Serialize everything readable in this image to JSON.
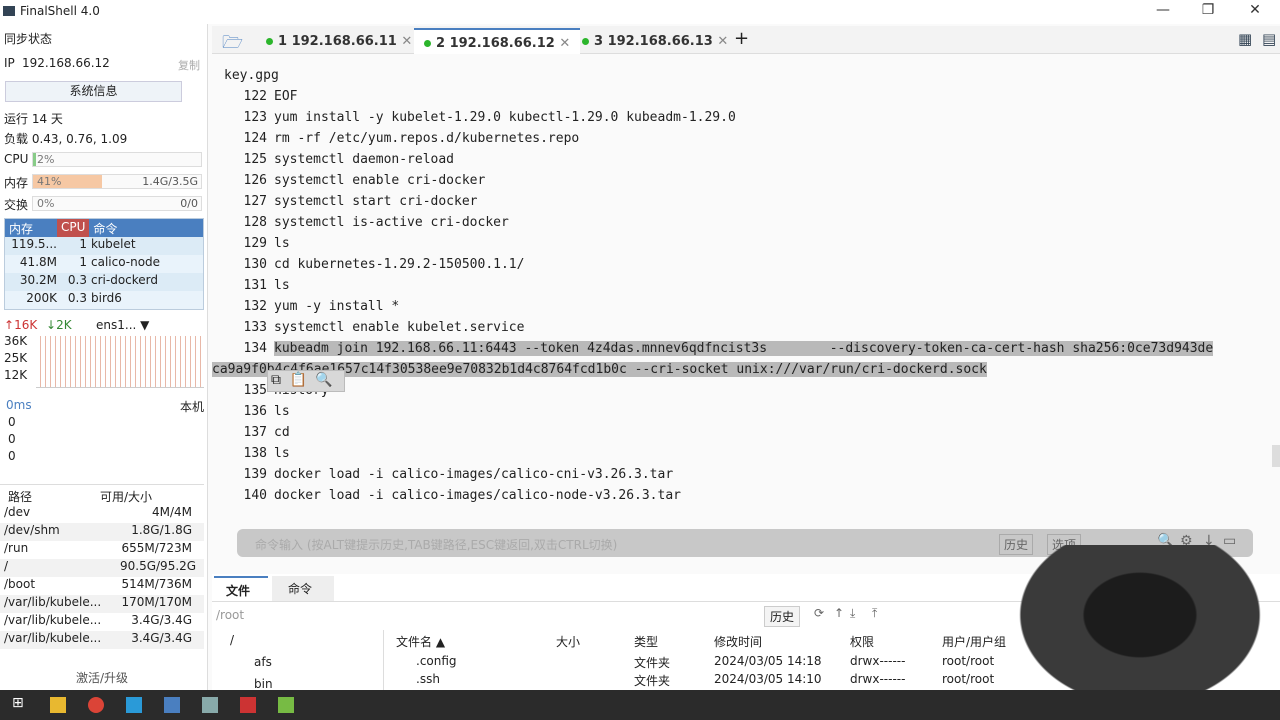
{
  "window": {
    "title": "FinalShell 4.0"
  },
  "sidebar": {
    "sync_label": "同步状态",
    "ip_label": "IP",
    "ip": "192.168.66.12",
    "copy_label": "复制",
    "sysinfo_button": "系统信息",
    "uptime": "运行 14 天",
    "load": "负载 0.43, 0.76, 1.09",
    "cpu": {
      "label": "CPU",
      "text": "2%",
      "percent": 2
    },
    "mem": {
      "label": "内存",
      "text": "41%",
      "percent": 41,
      "usage": "1.4G/3.5G"
    },
    "swap": {
      "label": "交换",
      "text": "0%",
      "percent": 0,
      "usage": "0/0"
    },
    "proc_headers": [
      "内存",
      "CPU",
      "命令"
    ],
    "processes": [
      {
        "mem": "119.5...",
        "cpu": "1",
        "cmd": "kubelet"
      },
      {
        "mem": "41.8M",
        "cpu": "1",
        "cmd": "calico-node"
      },
      {
        "mem": "30.2M",
        "cpu": "0.3",
        "cmd": "cri-dockerd"
      },
      {
        "mem": "200K",
        "cpu": "0.3",
        "cmd": "bird6"
      }
    ],
    "net": {
      "up": "16K",
      "down": "2K",
      "iface": "ens1...",
      "ticks": [
        "36K",
        "25K",
        "12K"
      ]
    },
    "ping": {
      "label": "0ms",
      "host": "本机",
      "values": [
        "0",
        "0",
        "0"
      ]
    },
    "disk_headers": [
      "路径",
      "可用/大小"
    ],
    "disks": [
      {
        "path": "/dev",
        "size": "4M/4M"
      },
      {
        "path": "/dev/shm",
        "size": "1.8G/1.8G"
      },
      {
        "path": "/run",
        "size": "655M/723M"
      },
      {
        "path": "/",
        "size": "90.5G/95.2G"
      },
      {
        "path": "/boot",
        "size": "514M/736M"
      },
      {
        "path": "/var/lib/kubele...",
        "size": "170M/170M"
      },
      {
        "path": "/var/lib/kubele...",
        "size": "3.4G/3.4G"
      },
      {
        "path": "/var/lib/kubele...",
        "size": "3.4G/3.4G"
      }
    ],
    "activate": "激活/升级"
  },
  "tabs": [
    {
      "label": "1 192.168.66.11"
    },
    {
      "label": "2 192.168.66.12"
    },
    {
      "label": "3 192.168.66.13"
    }
  ],
  "terminal": {
    "first": "key.gpg",
    "lines": [
      {
        "n": "122",
        "t": "EOF"
      },
      {
        "n": "123",
        "t": "yum install -y kubelet-1.29.0 kubectl-1.29.0 kubeadm-1.29.0"
      },
      {
        "n": "124",
        "t": "rm -rf /etc/yum.repos.d/kubernetes.repo"
      },
      {
        "n": "125",
        "t": "systemctl daemon-reload"
      },
      {
        "n": "126",
        "t": "systemctl enable cri-docker"
      },
      {
        "n": "127",
        "t": "systemctl start cri-docker"
      },
      {
        "n": "128",
        "t": "systemctl is-active cri-docker"
      },
      {
        "n": "129",
        "t": "ls"
      },
      {
        "n": "130",
        "t": "cd kubernetes-1.29.2-150500.1.1/"
      },
      {
        "n": "131",
        "t": "ls"
      },
      {
        "n": "132",
        "t": "yum -y install *"
      },
      {
        "n": "133",
        "t": "systemctl enable kubelet.service"
      },
      {
        "n": "134",
        "t": "kubeadm join 192.168.66.11:6443 --token 4z4das.mnnev6qdfncist3s        --discovery-token-ca-cert-hash sha256:0ce73d943de"
      },
      {
        "n": "",
        "t": "ca9a9f0b4c4f6ae1657c14f30538ee9e70832b1d4c8764fcd1b0c --cri-socket unix:///var/run/cri-dockerd.sock"
      },
      {
        "n": "135",
        "t": "history"
      },
      {
        "n": "136",
        "t": "ls"
      },
      {
        "n": "137",
        "t": "cd"
      },
      {
        "n": "138",
        "t": "ls"
      },
      {
        "n": "139",
        "t": "docker load -i calico-images/calico-cni-v3.26.3.tar"
      },
      {
        "n": "140",
        "t": "docker load -i calico-images/calico-node-v3.26.3.tar"
      }
    ]
  },
  "cmdbar": {
    "placeholder": "命令输入 (按ALT键提示历史,TAB键路径,ESC键返回,双击CTRL切换)",
    "history": "历史",
    "options": "选项"
  },
  "files": {
    "tabs": [
      "文件",
      "命令"
    ],
    "path": "/root",
    "history": "历史",
    "tree": [
      "/",
      "afs",
      "bin"
    ],
    "headers": [
      "文件名 ▲",
      "大小",
      "类型",
      "修改时间",
      "权限",
      "用户/用户组"
    ],
    "rows": [
      {
        "name": ".config",
        "size": "",
        "type": "文件夹",
        "mtime": "2024/03/05 14:18",
        "perm": "drwx------",
        "owner": "root/root"
      },
      {
        "name": ".ssh",
        "size": "",
        "type": "文件夹",
        "mtime": "2024/03/05 14:10",
        "perm": "drwx------",
        "owner": "root/root"
      }
    ]
  }
}
